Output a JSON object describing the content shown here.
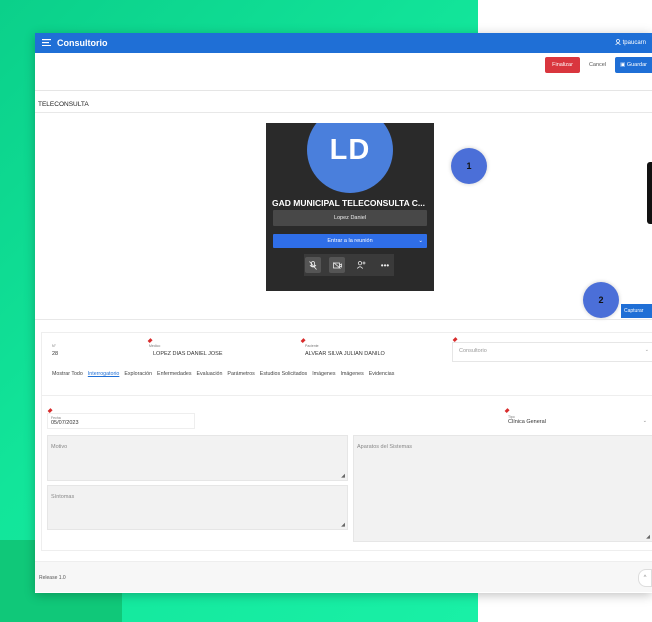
{
  "app": {
    "title": "Consultorio",
    "user": "tpaucarn"
  },
  "toolbar": {
    "finalizar": "Finalizar",
    "cancel": "Cancel",
    "guardar": "Guardar"
  },
  "section": {
    "title": "TELECONSULTA"
  },
  "meeting": {
    "initials": "LD",
    "title": "GAD MUNICIPAL TELECONSULTA C...",
    "name_value": "Lopez Daniel",
    "join_label": "Entrar a la reunión",
    "more_label": "•••"
  },
  "badges": {
    "one": "1",
    "two": "2"
  },
  "capture": {
    "label": "Capturar"
  },
  "form": {
    "n_label": "N°",
    "n_value": "28",
    "medico_label": "Medico",
    "medico_value": "LOPEZ DIAS DANIEL JOSE",
    "paciente_label": "Paciente",
    "paciente_value": "ALVEAR SILVA JULIAN DANILO",
    "consultorio_placeholder": "Consultorio"
  },
  "tabs": [
    "Mostrar Todo",
    "Interrogatorio",
    "Exploración",
    "Enfermedades",
    "Evaluación",
    "Parámetros",
    "Estudios Solicitados",
    "Imágenes",
    "Imágenes",
    "Evidencias"
  ],
  "interrogatorio": {
    "fecha_label": "Fecha",
    "fecha_value": "05/07/2023",
    "tipo_label": "Tipo",
    "tipo_value": "Clínica General",
    "motivo_placeholder": "Motivo",
    "aparatos_placeholder": "Aparatos del Sistemas",
    "sintomas_placeholder": "Síntomas"
  },
  "footer": {
    "release": "Release 1.0"
  },
  "colors": {
    "brand": "#1f6fd6",
    "danger": "#d9363e",
    "bg_green": "#12e59a",
    "badge": "#4b6fd8"
  }
}
